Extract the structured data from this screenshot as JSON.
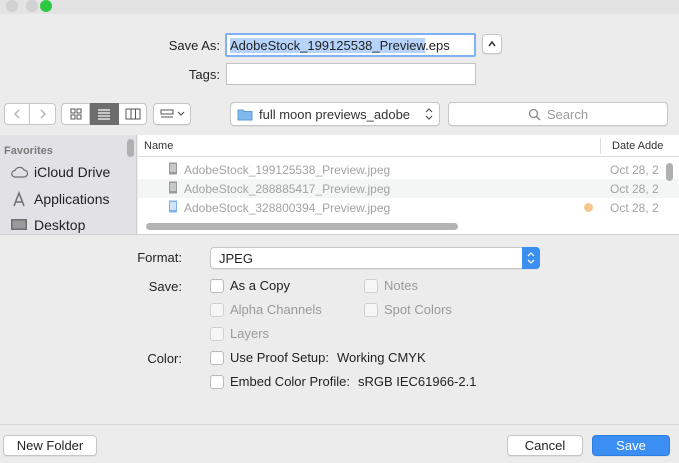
{
  "save_as": {
    "label": "Save As:",
    "value_selected": "AdobeStock_199125538_Preview",
    "value_rest": ".eps"
  },
  "tags": {
    "label": "Tags:",
    "value": ""
  },
  "toolbar": {
    "location": "full moon previews_adobe",
    "search_placeholder": "Search"
  },
  "sidebar": {
    "section": "Favorites",
    "items": [
      "iCloud Drive",
      "Applications",
      "Desktop"
    ]
  },
  "file_list": {
    "columns": [
      "Name",
      "Date Adde"
    ],
    "rows": [
      {
        "name": "AdobeStock_199125538_Preview.jpeg",
        "date": "Oct 28, 2"
      },
      {
        "name": "AdobeStock_288885417_Preview.jpeg",
        "date": "Oct 28, 2"
      },
      {
        "name": "AdobeStock_328800394_Preview.jpeg",
        "date": "Oct 28, 2"
      }
    ]
  },
  "format": {
    "label": "Format:",
    "value": "JPEG"
  },
  "save_options": {
    "label": "Save:",
    "as_a_copy": "As a Copy",
    "notes": "Notes",
    "alpha_channels": "Alpha Channels",
    "spot_colors": "Spot Colors",
    "layers": "Layers"
  },
  "color": {
    "label": "Color:",
    "use_proof_setup": "Use Proof Setup:",
    "proof_value": "Working CMYK",
    "embed_profile": "Embed Color Profile:",
    "profile_value": "sRGB IEC61966-2.1"
  },
  "buttons": {
    "new_folder": "New Folder",
    "cancel": "Cancel",
    "save": "Save"
  },
  "colors": {
    "accent": "#3b8ff3",
    "selection": "#b6d4fb",
    "tag_orange": "#f5c78e"
  },
  "icons": [
    "folder-icon",
    "search-icon",
    "cloud-icon",
    "applications-icon",
    "desktop-icon",
    "file-icon"
  ]
}
